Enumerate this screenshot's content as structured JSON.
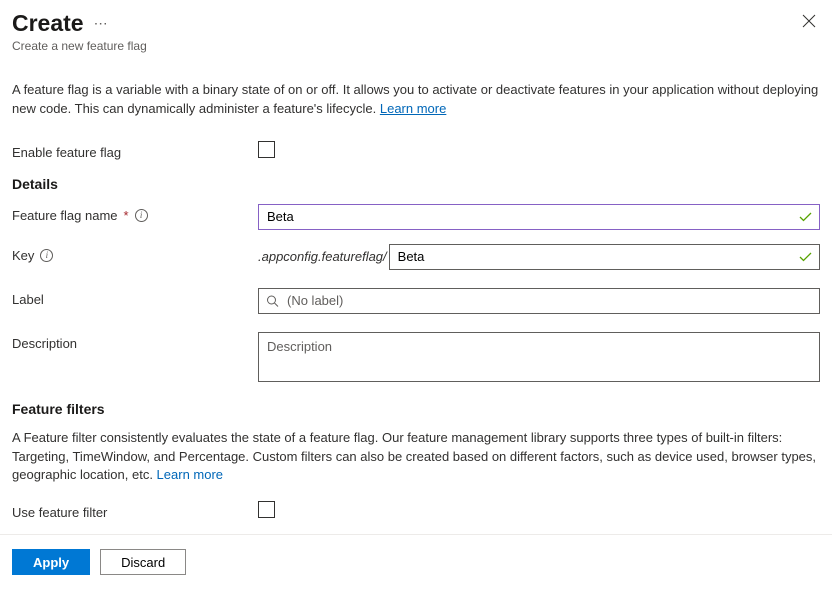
{
  "header": {
    "title": "Create",
    "subtitle": "Create a new feature flag"
  },
  "intro": {
    "text": "A feature flag is a variable with a binary state of on or off. It allows you to activate or deactivate features in your application without deploying new code. This can dynamically administer a feature's lifecycle. ",
    "learn_more": "Learn more"
  },
  "form": {
    "enable_label": "Enable feature flag",
    "details_heading": "Details",
    "name": {
      "label": "Feature flag name",
      "value": "Beta"
    },
    "key": {
      "label": "Key",
      "prefix": ".appconfig.featureflag/",
      "value": "Beta"
    },
    "label_field": {
      "label": "Label",
      "placeholder": "(No label)"
    },
    "description": {
      "label": "Description",
      "placeholder": "Description"
    }
  },
  "filters": {
    "heading": "Feature filters",
    "desc": "A Feature filter consistently evaluates the state of a feature flag. Our feature management library supports three types of built-in filters: Targeting, TimeWindow, and Percentage. Custom filters can also be created based on different factors, such as device used, browser types, geographic location, etc. ",
    "learn_more": "Learn more",
    "use_label": "Use feature filter"
  },
  "footer": {
    "apply": "Apply",
    "discard": "Discard"
  }
}
